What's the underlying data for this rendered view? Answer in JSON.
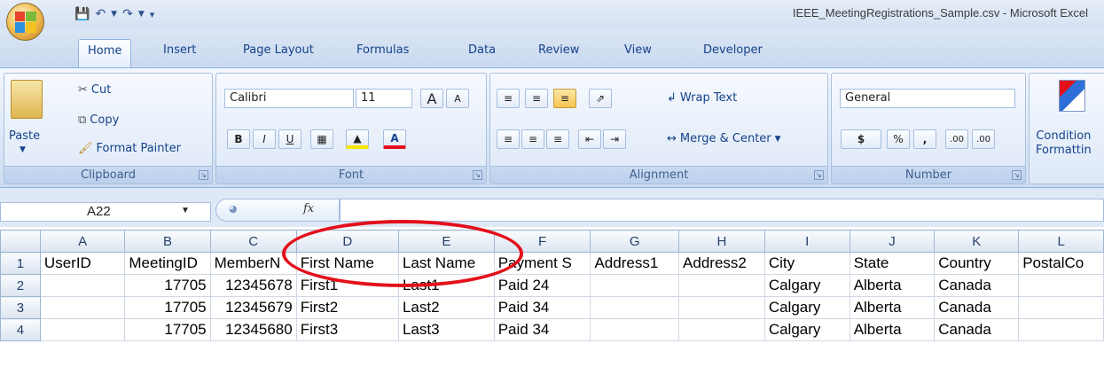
{
  "window": {
    "title": "IEEE_MeetingRegistrations_Sample.csv - Microsoft Excel"
  },
  "quick_access": {
    "save_icon": "save-icon",
    "undo_icon": "undo-icon",
    "redo_icon": "redo-icon"
  },
  "tabs": [
    {
      "label": "Home",
      "active": true
    },
    {
      "label": "Insert"
    },
    {
      "label": "Page Layout"
    },
    {
      "label": "Formulas"
    },
    {
      "label": "Data"
    },
    {
      "label": "Review"
    },
    {
      "label": "View"
    },
    {
      "label": "Developer"
    }
  ],
  "ribbon": {
    "clipboard": {
      "label": "Clipboard",
      "paste": "Paste",
      "cut": "Cut",
      "copy": "Copy",
      "format_painter": "Format Painter"
    },
    "font": {
      "label": "Font",
      "name": "Calibri",
      "size": "11",
      "bold": "B",
      "italic": "I",
      "underline": "U",
      "grow": "A",
      "shrink": "A",
      "font_color": "A"
    },
    "alignment": {
      "label": "Alignment",
      "wrap_text": "Wrap Text",
      "merge_center": "Merge & Center"
    },
    "number": {
      "label": "Number",
      "format": "General",
      "currency": "$",
      "percent": "%",
      "comma": ",",
      "inc_dec": ".00",
      "dec_dec": ".00"
    },
    "styles": {
      "conditional_line1": "Condition",
      "conditional_line2": "Formattin"
    }
  },
  "formula_bar": {
    "name_box": "A22",
    "fx": "fx",
    "value": ""
  },
  "grid": {
    "columns": [
      "A",
      "B",
      "C",
      "D",
      "E",
      "F",
      "G",
      "H",
      "I",
      "J",
      "K",
      "L"
    ],
    "rows": [
      {
        "num": "1",
        "cells": [
          "UserID",
          "MeetingID",
          "MemberN",
          "First Name",
          "Last Name",
          "Payment S",
          "Address1",
          "Address2",
          "City",
          "State",
          "Country",
          "PostalCo"
        ]
      },
      {
        "num": "2",
        "cells": [
          "",
          "17705",
          "12345678",
          "First1",
          "Last1",
          "Paid 24",
          "",
          "",
          "Calgary",
          "Alberta",
          "Canada",
          ""
        ]
      },
      {
        "num": "3",
        "cells": [
          "",
          "17705",
          "12345679",
          "First2",
          "Last2",
          "Paid 34",
          "",
          "",
          "Calgary",
          "Alberta",
          "Canada",
          ""
        ]
      },
      {
        "num": "4",
        "cells": [
          "",
          "17705",
          "12345680",
          "First3",
          "Last3",
          "Paid 34",
          "",
          "",
          "Calgary",
          "Alberta",
          "Canada",
          ""
        ]
      }
    ]
  },
  "annotation": {
    "color": "#e3101a",
    "shape": "ellipse around columns D and E headers"
  }
}
